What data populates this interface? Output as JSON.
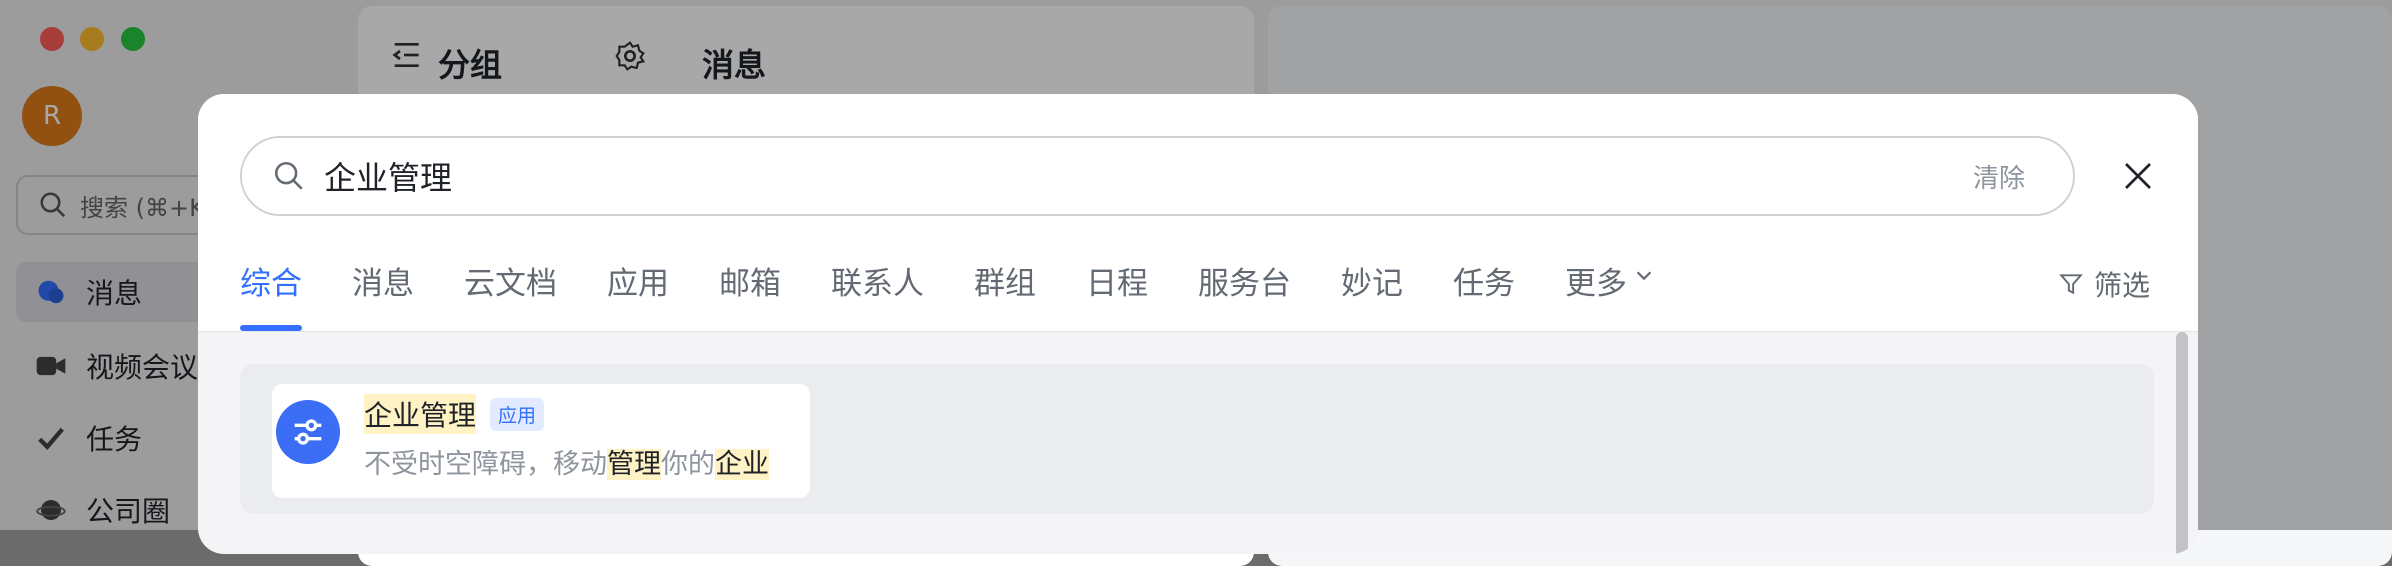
{
  "background_app": {
    "avatar_initial": "R",
    "search_placeholder": "搜索 (⌘+K)",
    "sidebar": [
      {
        "label": "消息",
        "icon": "chat-bubble-icon",
        "active": true
      },
      {
        "label": "视频会议",
        "icon": "video-camera-icon",
        "active": false
      },
      {
        "label": "任务",
        "icon": "check-task-icon",
        "active": false
      },
      {
        "label": "公司圈",
        "icon": "planet-icon",
        "active": false
      }
    ],
    "group_header": "分组",
    "messages_header": "消息"
  },
  "search": {
    "query": "企业管理",
    "clear_label": "清除",
    "filter_label": "筛选"
  },
  "tabs": [
    "综合",
    "消息",
    "云文档",
    "应用",
    "邮箱",
    "联系人",
    "群组",
    "日程",
    "服务台",
    "妙记",
    "任务",
    "更多"
  ],
  "active_tab": "综合",
  "result": {
    "title": "企业管理",
    "badge": "应用",
    "desc_part1": "不受时空障碍，移动",
    "desc_hl1": "管理",
    "desc_part2": "你的",
    "desc_hl2": "企业"
  },
  "colors": {
    "accent": "#3370ff",
    "highlight": "#fff2c4",
    "app_icon": "#3b6ef5"
  }
}
